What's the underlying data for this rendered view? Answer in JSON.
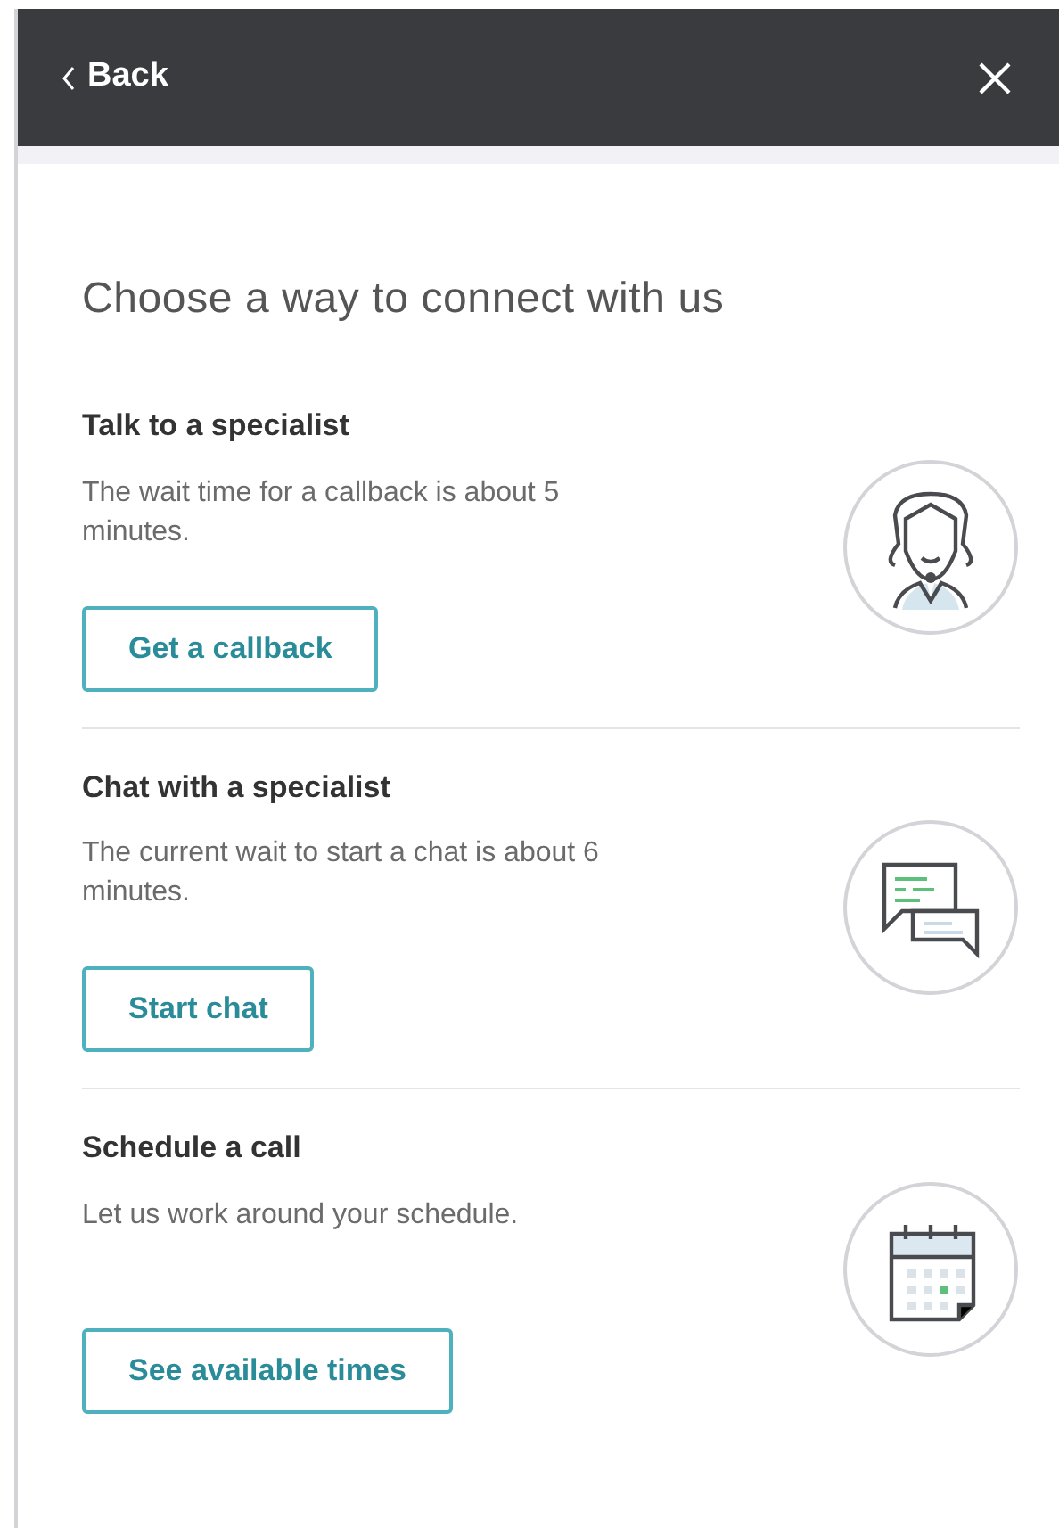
{
  "header": {
    "back": "Back"
  },
  "title": "Choose a way to connect with us",
  "options": [
    {
      "kind": "callback",
      "heading": "Talk to a specialist",
      "description": "The wait time for a callback is about 5 minutes.",
      "button": "Get a callback"
    },
    {
      "kind": "chat",
      "heading": "Chat with a specialist",
      "description": "The current wait to start a chat is about 6 minutes.",
      "button": "Start chat"
    },
    {
      "kind": "schedule",
      "heading": "Schedule a call",
      "description": "Let us work around your schedule.",
      "button": "See available times"
    }
  ]
}
